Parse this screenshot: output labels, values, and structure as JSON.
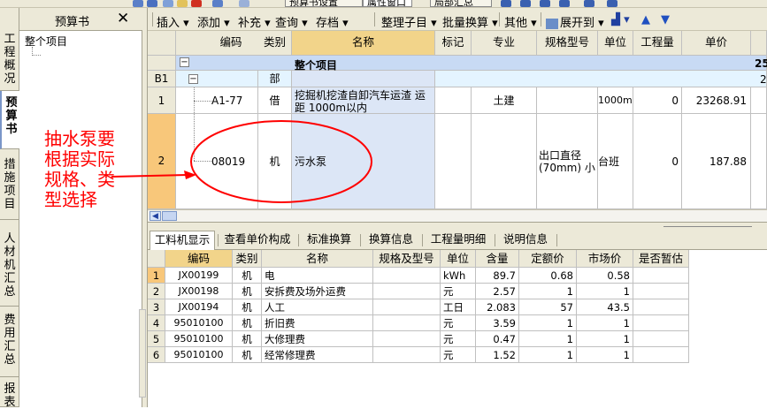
{
  "top_toolbar": {
    "items": [
      "预算书设置",
      "属性窗口",
      "局部汇总"
    ]
  },
  "left_tabs": [
    "工程概况",
    "预算书",
    "措施项目",
    "人材机汇总",
    "费用汇总",
    "报表"
  ],
  "left_panel": {
    "title": "预算书",
    "close_icon": "✕",
    "tree_root": "整个项目"
  },
  "toolbar": {
    "insert": "插入",
    "add": "添加",
    "supplement": "补充",
    "query": "查询",
    "archive": "存档",
    "organize": "整理子目",
    "batch": "批量换算",
    "other": "其他",
    "expand": "展开到"
  },
  "main_table": {
    "columns": [
      "编码",
      "类别",
      "名称",
      "标记",
      "专业",
      "规格型号",
      "单位",
      "工程量",
      "单价"
    ],
    "rows": [
      {
        "rownum": "",
        "expander": "−",
        "code": "",
        "type": "",
        "name": "整个项目",
        "mark": "",
        "major": "",
        "spec": "",
        "unit": "",
        "qty": "",
        "price": "",
        "extra": "25"
      },
      {
        "rownum": "B1",
        "expander": "−",
        "code": "",
        "type": "部",
        "name": "",
        "mark": "",
        "major": "",
        "spec": "",
        "unit": "",
        "qty": "",
        "price": "",
        "extra": "2"
      },
      {
        "rownum": "1",
        "expander": "",
        "code": "A1-77",
        "type": "借",
        "name": "挖掘机挖渣自卸汽车运渣 运距 1000m以内",
        "mark": "",
        "major": "土建",
        "spec": "",
        "unit": "1000m3",
        "qty": "0",
        "price": "23268.91",
        "extra": ""
      },
      {
        "rownum": "2",
        "expander": "",
        "code": "08019",
        "type": "机",
        "name": "污水泵",
        "mark": "",
        "major": "",
        "spec": "出口直径(70mm) 小",
        "unit": "台班",
        "qty": "0",
        "price": "187.88",
        "extra": ""
      }
    ]
  },
  "bottom_tabs": [
    "工料机显示",
    "查看单价构成",
    "标准换算",
    "换算信息",
    "工程量明细",
    "说明信息"
  ],
  "bottom_table": {
    "columns": [
      "编码",
      "类别",
      "名称",
      "规格及型号",
      "单位",
      "含量",
      "定额价",
      "市场价",
      "是否暂估"
    ],
    "rows": [
      {
        "n": "1",
        "code": "JX00199",
        "type": "机",
        "name": "电",
        "spec": "",
        "unit": "kWh",
        "content": "89.7",
        "quota": "0.68",
        "market": "0.58",
        "est": ""
      },
      {
        "n": "2",
        "code": "JX00198",
        "type": "机",
        "name": "安拆费及场外运费",
        "spec": "",
        "unit": "元",
        "content": "2.57",
        "quota": "1",
        "market": "1",
        "est": ""
      },
      {
        "n": "3",
        "code": "JX00194",
        "type": "机",
        "name": "人工",
        "spec": "",
        "unit": "工日",
        "content": "2.083",
        "quota": "57",
        "market": "43.5",
        "est": ""
      },
      {
        "n": "4",
        "code": "95010100",
        "type": "机",
        "name": "折旧费",
        "spec": "",
        "unit": "元",
        "content": "3.59",
        "quota": "1",
        "market": "1",
        "est": ""
      },
      {
        "n": "5",
        "code": "95010100",
        "type": "机",
        "name": "大修理费",
        "spec": "",
        "unit": "元",
        "content": "0.47",
        "quota": "1",
        "market": "1",
        "est": ""
      },
      {
        "n": "6",
        "code": "95010100",
        "type": "机",
        "name": "经常修理费",
        "spec": "",
        "unit": "元",
        "content": "1.52",
        "quota": "1",
        "market": "1",
        "est": ""
      }
    ]
  },
  "annotation": {
    "text": "抽水泵要根据实际规格、类型选择",
    "color": "#ff0000"
  },
  "colors": {
    "selected_header": "#f2d48a",
    "selected_row_num": "#f8c77a",
    "summary_row": "#c8daf4",
    "name_column": "#dce6f6",
    "panel_bg": "#ece9d8"
  }
}
